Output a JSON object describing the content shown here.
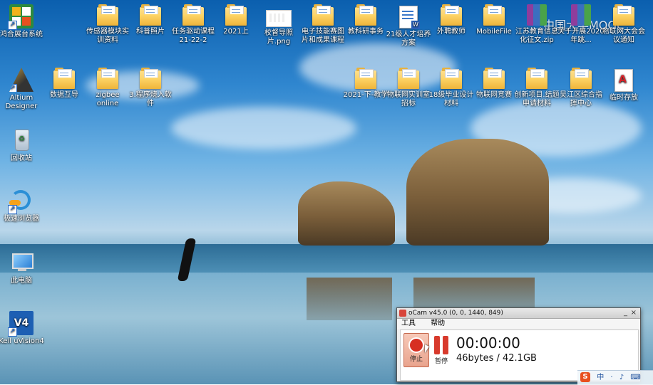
{
  "desktop": {
    "icons_left": [
      {
        "label": "鸿合展台系统",
        "icon": "hitevision-icon"
      },
      {
        "label": "Altium Designer",
        "icon": "altium-designer-icon"
      },
      {
        "label": "回收站",
        "icon": "recycle-bin-icon"
      },
      {
        "label": "极速浏览器",
        "icon": "browser-icon"
      },
      {
        "label": "此电脑",
        "icon": "this-pc-icon"
      },
      {
        "label": "Keil uVision4",
        "icon": "keil-icon"
      }
    ],
    "icons_row1": [
      {
        "label": "传感器模块实训资料",
        "icon": "folder-icon"
      },
      {
        "label": "科普照片",
        "icon": "folder-icon"
      },
      {
        "label": "任务驱动课程21-22-2",
        "icon": "folder-icon"
      },
      {
        "label": "2021上",
        "icon": "folder-icon"
      },
      {
        "label": "校督导照片.png",
        "icon": "image-file-icon"
      },
      {
        "label": "电子技能赛图片和成果课程",
        "icon": "folder-icon"
      },
      {
        "label": "教科研事务",
        "icon": "folder-icon"
      },
      {
        "label": "21级人才培养方案",
        "icon": "word-file-icon"
      },
      {
        "label": "外聘教师",
        "icon": "folder-icon"
      },
      {
        "label": "MobileFile",
        "icon": "folder-icon"
      },
      {
        "label": "江苏教育信息化征文.zip",
        "icon": "winrar-icon"
      },
      {
        "label": "关于开展2020年跳...",
        "icon": "winrar-icon"
      },
      {
        "label": "物联网大会会议通知",
        "icon": "folder-icon"
      }
    ],
    "icons_row2": [
      {
        "label": "数据互导",
        "icon": "folder-icon"
      },
      {
        "label": "zigbee online",
        "icon": "folder-icon"
      },
      {
        "label": "3.程序烧入软件",
        "icon": "folder-icon"
      },
      {
        "label": "2021-下-教学",
        "icon": "folder-icon"
      },
      {
        "label": "物联网实训室招标",
        "icon": "folder-icon"
      },
      {
        "label": "18级毕业设计材料",
        "icon": "folder-icon"
      },
      {
        "label": "物联网竞赛",
        "icon": "folder-icon"
      },
      {
        "label": "创新项目.结题申请材料",
        "icon": "folder-icon"
      },
      {
        "label": "吴江区综合指挥中心",
        "icon": "folder-icon"
      },
      {
        "label": "临时存放",
        "icon": "pdf-file-icon"
      }
    ],
    "watermark": "中国大学MOOC"
  },
  "ocam": {
    "title": "oCam v45.0 (0, 0, 1440, 849)",
    "menu": [
      "工具",
      "帮助"
    ],
    "stop_label": "停止",
    "pause_label": "暂停",
    "time": "00:00:00",
    "size": "46bytes / 42.1GB",
    "controls": {
      "minimize": "_",
      "close": "×"
    }
  },
  "tray": {
    "ime": "S",
    "lang": "中",
    "items": [
      "·",
      "♪",
      "⌨"
    ]
  }
}
